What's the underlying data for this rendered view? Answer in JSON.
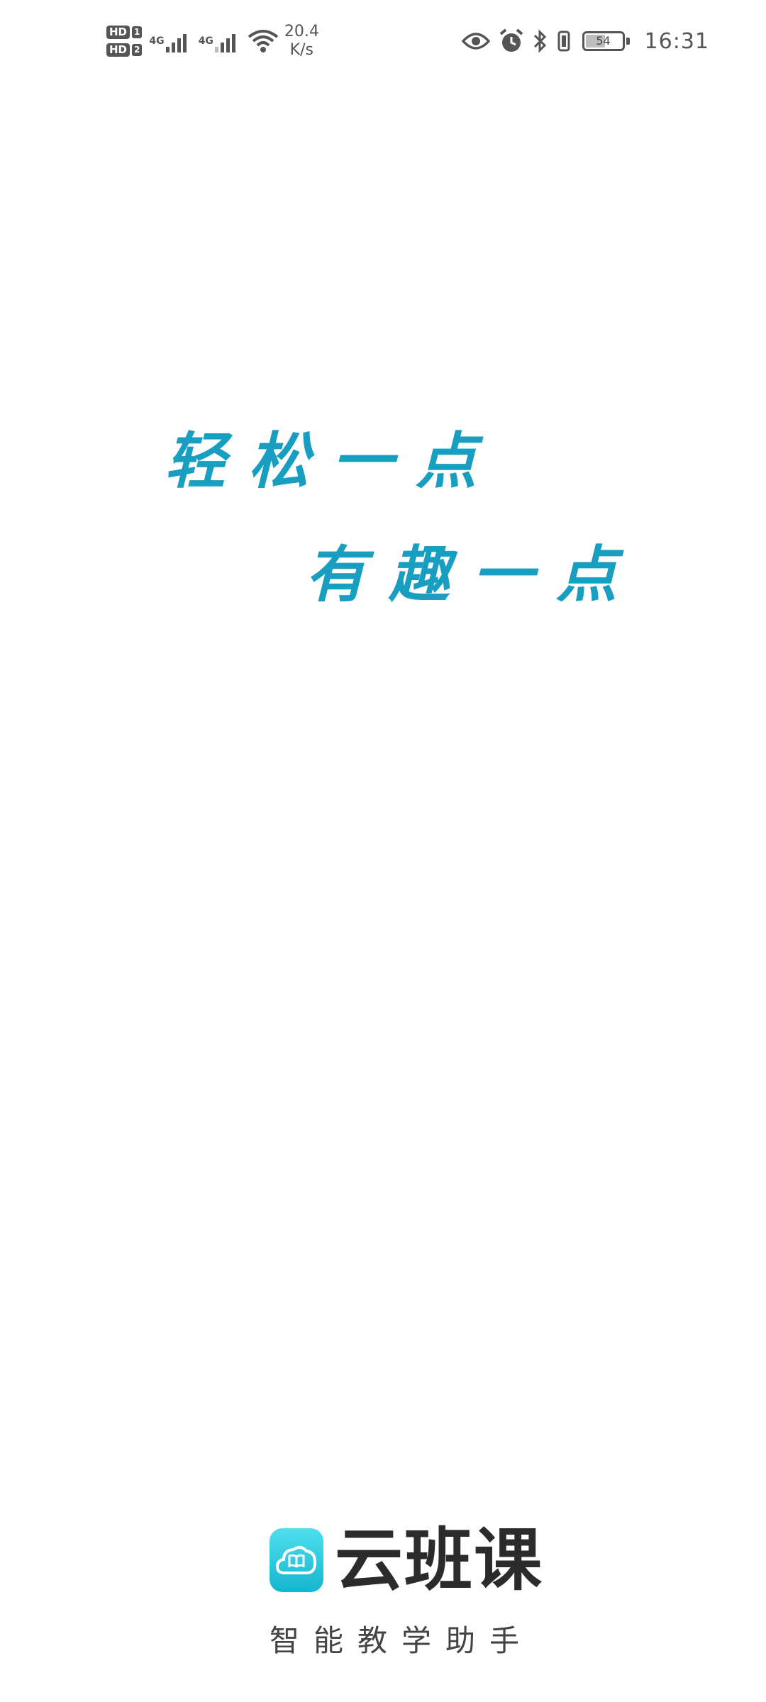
{
  "status_bar": {
    "sim1_hd": "HD",
    "sim1_num": "1",
    "sim2_hd": "HD",
    "sim2_num": "2",
    "net1_label": "4G",
    "net2_label": "4G",
    "speed_value": "20.4",
    "speed_unit": "K/s",
    "battery_level": "54",
    "battery_fraction": 0.54,
    "time": "16:31",
    "icons": [
      "eye-icon",
      "alarm-icon",
      "bluetooth-icon",
      "vibrate-icon",
      "battery-icon"
    ]
  },
  "slogan": {
    "line1": "轻松一点",
    "line2": "有趣一点",
    "color": "#189ec1"
  },
  "brand": {
    "name": "云班课",
    "tagline": "智能教学助手",
    "logo_color": "#15b4cf"
  }
}
